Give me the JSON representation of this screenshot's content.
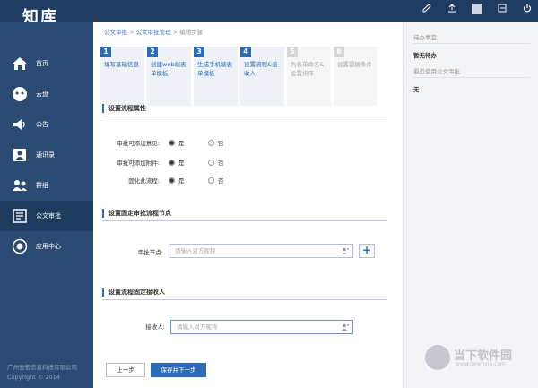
{
  "app": {
    "logo": "知库"
  },
  "topbar": {
    "icons": [
      "edit-icon",
      "upload-icon",
      "user-avatar",
      "logout-icon",
      "power-icon"
    ]
  },
  "sidebar": {
    "items": [
      {
        "label": "首页",
        "icon": "home-icon"
      },
      {
        "label": "云盘",
        "icon": "cloud-icon"
      },
      {
        "label": "公告",
        "icon": "speaker-icon"
      },
      {
        "label": "通讯录",
        "icon": "contacts-icon"
      },
      {
        "label": "群组",
        "icon": "group-icon"
      },
      {
        "label": "公文审批",
        "icon": "approval-icon",
        "active": true
      },
      {
        "label": "应用中心",
        "icon": "app-center-icon"
      }
    ],
    "footer_company": "广州云宏信息科技有限公司",
    "footer_copyright": "Copyright © 2014"
  },
  "breadcrumb": {
    "part1": "公文审批",
    "sep1": " > ",
    "part2": "公文审批管理",
    "sep2": " > ",
    "part3": "编辑步骤"
  },
  "steps": [
    {
      "num": "1",
      "text": "填写基础信息",
      "active": true
    },
    {
      "num": "2",
      "text": "创建web端表单模板",
      "active": true
    },
    {
      "num": "3",
      "text": "生成手机端表单模板",
      "active": true
    },
    {
      "num": "4",
      "text": "设置流程&接收人",
      "active": true
    },
    {
      "num": "5",
      "text": "为表单命名&设置排序",
      "active": false
    },
    {
      "num": "6",
      "text": "设置提醒条件",
      "active": false
    }
  ],
  "sections": {
    "properties": {
      "title": "设置流程属性",
      "rows": [
        {
          "label": "审批可添加意见:",
          "yes": "是",
          "no": "否",
          "selected": "yes"
        },
        {
          "label": "审批可添加附件:",
          "yes": "是",
          "no": "否",
          "selected": "yes"
        },
        {
          "label": "固化此流程:",
          "yes": "是",
          "no": "否",
          "selected": "yes"
        }
      ]
    },
    "nodes": {
      "title": "设置固定审批流程节点",
      "label": "审批节点:",
      "placeholder": "请输入对方昵称"
    },
    "receiver": {
      "title": "设置流程固定接收人",
      "label": "接收人:",
      "placeholder": "请输入对方昵称"
    }
  },
  "actions": {
    "prev": "上一步",
    "next": "保存并下一步"
  },
  "rightpanel": {
    "todo_title": "待办事宜",
    "todo_value": "暂无待办",
    "recent_title": "最近使用公文审批",
    "recent_value": "无"
  },
  "watermark": {
    "name": "当下软件园",
    "url": "www.downxia.com"
  }
}
